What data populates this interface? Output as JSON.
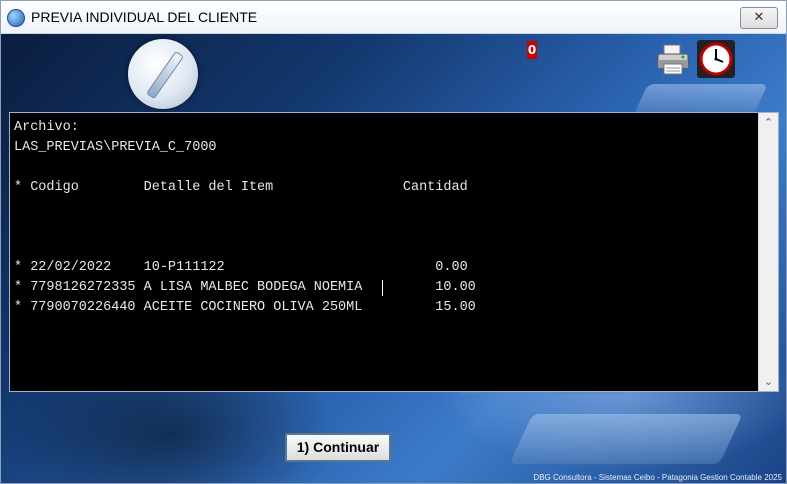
{
  "window": {
    "title": "PREVIA INDIVIDUAL DEL CLIENTE",
    "close_glyph": "✕",
    "icons": [
      "app-icon",
      "printer-icon",
      "clock-icon",
      "logo-icon"
    ]
  },
  "header": {
    "badge": "0"
  },
  "console": {
    "lines": [
      "Archivo:",
      "LAS_PREVIAS\\PREVIA_C_7000",
      "",
      "* Codigo        Detalle del Item                Cantidad",
      "",
      "",
      "",
      "* 22/02/2022    10-P111122                          0.00",
      "* 7798126272335 A LISA MALBEC BODEGA NOEMIA         10.00",
      "* 7790070226440 ACEITE COCINERO OLIVA 250ML         15.00"
    ]
  },
  "scrollbar": {
    "up_glyph": "⌃",
    "down_glyph": "⌄"
  },
  "actions": {
    "continue_label": "1) Continuar"
  },
  "footer": {
    "credits": "DBG Consultora - Sistemas Ceibo - Patagonia Gestion Contable 2025"
  },
  "colors": {
    "console_bg": "#000000",
    "console_fg": "#e8e8e8",
    "badge_bg": "#cc0000"
  }
}
